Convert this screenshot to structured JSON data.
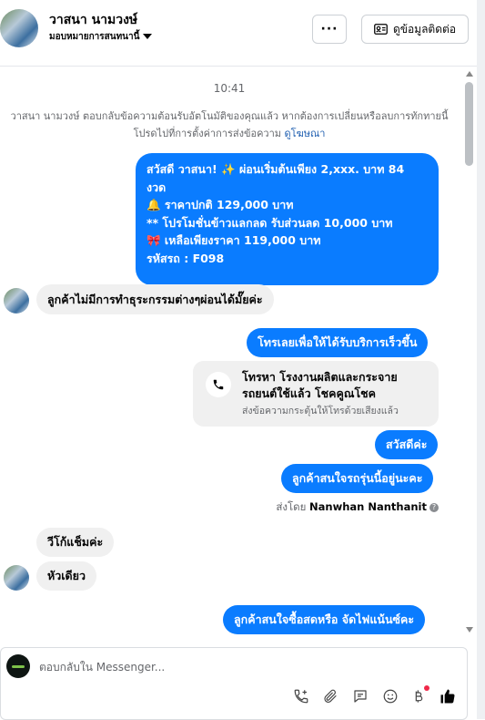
{
  "header": {
    "contact_name": "วาสนา นามวงษ์",
    "assign_label": "มอบหมายการสนทนานี้",
    "more_button": "···",
    "view_contact_label": "ดูข้อมูลติดต่อ"
  },
  "conversation": {
    "time": "10:41",
    "notice_text": "วาสนา นามวงษ์ ตอบกลับข้อความต้อนรับอัตโนมัติของคุณแล้ว หากต้องการเปลี่ยนหรือลบการทักทายนี้ โปรดไปที่การตั้งค่าการส่งข้อความ",
    "notice_link": "ดูโฆษณา",
    "messages": [
      {
        "direction": "out",
        "lines": [
          "สวัสดี วาสนา! ✨  ผ่อนเริ่มต้นเพียง 2,xxx. บาท 84",
          "งวด",
          "🔔 ราคาปกติ 129,000 บาท",
          "** โปรโมชั่นข้าวแลกลด รับส่วนลด 10,000 บาท",
          "🎀  เหลือเพียงราคา 119,000 บาท",
          " รหัสรถ : F098"
        ]
      },
      {
        "direction": "in",
        "text": "ลูกค้าไม่มีการทำธุระกรรมต่างๆผ่อนได้มั๊ยค่ะ"
      },
      {
        "direction": "out",
        "text": "โทรเลยเพื่อให้ได้รับบริการเร็วขึ้น"
      },
      {
        "direction": "out",
        "type": "call",
        "title": "โทรหา โรงงานผลิตและกระจายรถยนต์ใช้แล้ว โชคคูณโชค",
        "subtitle": "ส่งข้อความกระตุ้นให้โทรด้วยเสียงแล้ว"
      },
      {
        "direction": "out",
        "text": "สวัสดีค่ะ"
      },
      {
        "direction": "out",
        "text": "ลูกค้าสนใจรถรุ่นนี้อยู่นะคะ"
      },
      {
        "direction": "in",
        "text": "วีโก้แช็มค่ะ"
      },
      {
        "direction": "in",
        "text": "หัวเดียว"
      },
      {
        "direction": "out",
        "text": "ลูกค้าสนใจซื้อสดหรือ จัดไฟแน้นซ์คะ"
      }
    ],
    "sent_by_prefix": "ส่งโดย",
    "sent_by_name": "Nanwhan Nanthanit",
    "sent_by_help": "?"
  },
  "composer": {
    "placeholder": "ตอบกลับใน Messenger...",
    "tools": [
      "phone-plus-icon",
      "paperclip-icon",
      "saved-reply-icon",
      "emoji-icon",
      "baht-icon",
      "thumbs-up-icon"
    ]
  },
  "colors": {
    "outgoing_bubble": "#0a7cff",
    "incoming_bubble": "#f0f0f0",
    "link": "#1f5fb0",
    "notification_dot": "#f02849"
  }
}
